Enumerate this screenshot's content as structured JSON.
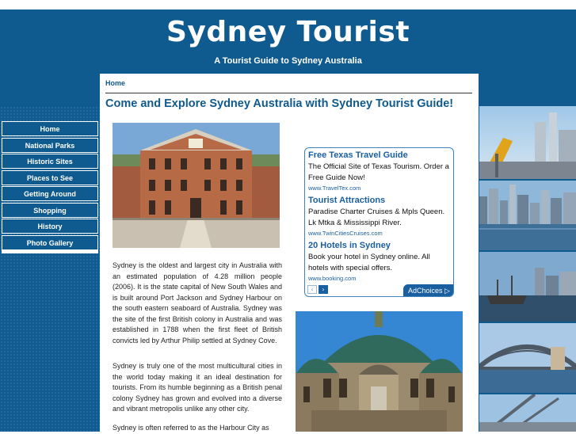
{
  "site": {
    "title": "Sydney Tourist",
    "tagline": "A Tourist Guide to Sydney Australia"
  },
  "breadcrumb": "Home",
  "page_heading": "Come and Explore Sydney Australia with Sydney Tourist Guide!",
  "nav": {
    "items": [
      {
        "label": "Home"
      },
      {
        "label": "National Parks"
      },
      {
        "label": "Historic Sites"
      },
      {
        "label": "Places to See"
      },
      {
        "label": "Getting Around"
      },
      {
        "label": "Shopping"
      },
      {
        "label": "History"
      },
      {
        "label": "Photo Gallery"
      }
    ]
  },
  "content": {
    "paragraphs": [
      "Sydney is the oldest and largest city in Australia with an estimated population of 4.28 million people (2006). It is the state capital of New South Wales and is built around Port Jackson and Sydney Harbour on the south eastern seaboard of Australia. Sydney was the site of the first British colony in Australia and was established in 1788 when the first fleet of British convicts led by Arthur Philip settled at Sydney Cove.",
      "Sydney is truly one of the most multicultural cities in the world today making it an ideal destination for tourists. From its humble beginning as a British penal colony Sydney has grown and evolved into a diverse and vibrant metropolis unlike any other city.",
      "Sydney is often referred to as the Harbour City as"
    ]
  },
  "ads": {
    "items": [
      {
        "title": "Free Texas Travel Guide",
        "description": "The Official Site of Texas Tourism. Order a Free Guide Now!",
        "url": "www.TravelTex.com"
      },
      {
        "title": "Tourist Attractions",
        "description": "Paradise Charter Cruises & Mpls Queen. Lk Mtka & Mississippi River.",
        "url": "www.TwinCitiesCruises.com"
      },
      {
        "title": "20 Hotels in Sydney",
        "description": "Book your hotel in Sydney online. All hotels with special offers.",
        "url": "www.booking.com"
      }
    ],
    "adchoices_label": "AdChoices ▷",
    "prev_icon": "‹",
    "next_icon": "›"
  },
  "colors": {
    "brand_blue": "#0f5a8e",
    "ad_blue": "#1a5fa0"
  },
  "icons": [
    "chevron-left-icon",
    "chevron-right-icon",
    "adchoices-icon"
  ]
}
